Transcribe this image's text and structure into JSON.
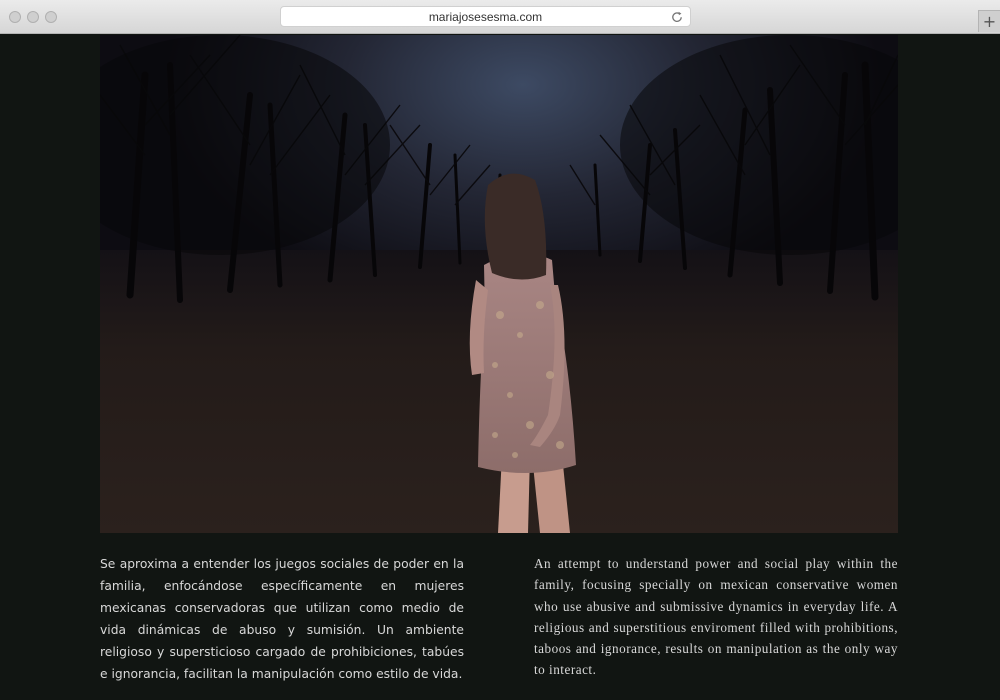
{
  "browser": {
    "url": "mariajosesesma.com",
    "new_tab_label": "+"
  },
  "content": {
    "text_es": "Se aproxima a entender los juegos sociales de poder en la familia, enfocándose específicamente en mujeres mexicanas conservadoras que utilizan como medio de vida dinámicas de abuso y sumisión. Un ambiente religioso y supersticioso cargado de prohibiciones, tabúes e ignorancia, facilitan la manipulación como estilo de vida.",
    "text_en": "An attempt to understand power and social play within the family, focusing specially on mexican conservative women who use abusive and submissive dynamics in everyday life. A religious and superstitious enviroment filled with prohibitions, taboos and ignorance, results on manipulation as the only way to interact."
  },
  "colors": {
    "page_background": "#111512",
    "text": "#d8d8d8"
  }
}
